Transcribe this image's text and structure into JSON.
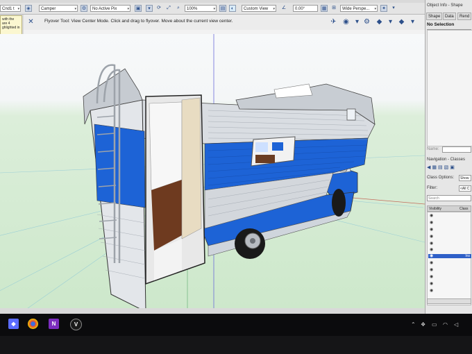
{
  "toolbar": {
    "menu_label": "Cnd1 t",
    "layer_value": "Camper",
    "pixel_value": "No Active Pix",
    "zoom_value": "100%",
    "view_value": "Custom View",
    "angle_value": "0.00°",
    "projection_value": "Wide Perspe..."
  },
  "tooltip": {
    "lines": [
      "with the",
      "are 4",
      "ghlighted in"
    ]
  },
  "mode_bar": {
    "mode_text": "Flyover Tool: View Center Mode. Click and drag to flyover. Move about the current view center."
  },
  "object_info": {
    "title": "Object Info - Shape",
    "tabs": [
      "Shape",
      "Data",
      "Rend"
    ],
    "selection": "No Selection",
    "name_label": "Name:"
  },
  "navigation": {
    "title": "Navigation - Classes",
    "class_options_label": "Class Options:",
    "class_options_value": "Show",
    "filter_label": "Filter:",
    "filter_value": "<All C",
    "search_placeholder": "Search",
    "columns": {
      "visibility": "Visibility",
      "class": "Class"
    },
    "selected_row_text": "Ins"
  },
  "taskbar": {
    "app_letters": {
      "onenote": "N",
      "vectorworks": "V"
    }
  },
  "colors": {
    "camper_blue": "#1d63d6",
    "selection_blue": "#2f60c8",
    "grass": "#cde8cb"
  },
  "icons": [
    "windows-start-icon",
    "chrome-icon",
    "onenote-icon",
    "vectorworks-icon",
    "flyover-tool-icon",
    "save-icon",
    "zoom-icon"
  ]
}
